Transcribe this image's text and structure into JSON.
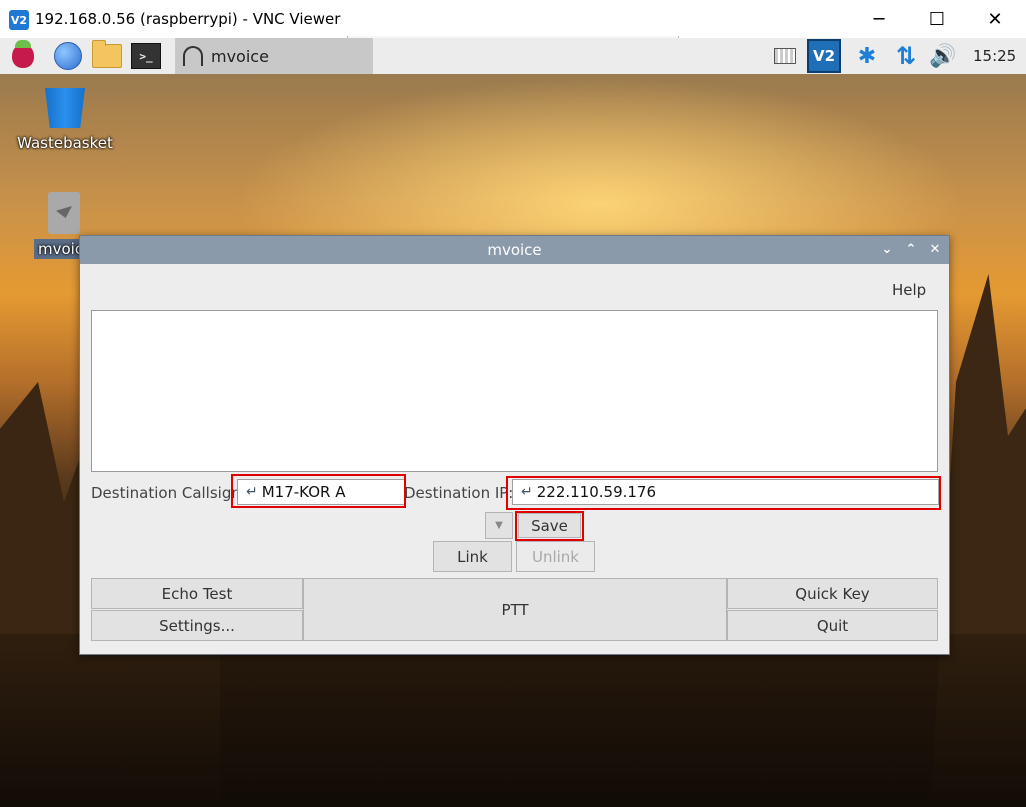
{
  "host": {
    "title": "192.168.0.56 (raspberrypi) - VNC Viewer",
    "logo_text": "V2",
    "controls": {
      "minimize": "─",
      "maximize": "☐",
      "close": "✕"
    }
  },
  "taskbar": {
    "icons": [
      "raspberry-menu-icon",
      "web-browser-icon",
      "file-manager-icon",
      "terminal-icon"
    ],
    "terminal_glyph": ">_",
    "active_task": "mvoice",
    "tray": {
      "vnc_text": "V2",
      "bluetooth": "✱",
      "network": "⇅",
      "volume": "🔊"
    },
    "clock": "15:25"
  },
  "desktop": {
    "items": [
      {
        "label": "Wastebasket",
        "icon": "wastebasket-icon"
      },
      {
        "label": "mvoice",
        "icon": "mvoice-file-icon"
      }
    ]
  },
  "mvoice_window": {
    "title": "mvoice",
    "controls": {
      "minimize": "⌄",
      "maximize": "⌃",
      "close": "✕"
    },
    "menu": {
      "help": "Help"
    },
    "log_text": "",
    "destination_callsign": {
      "label": "Destination Callsign:",
      "value": "M17-KOR A"
    },
    "destination_ip": {
      "label": "Destination IP:",
      "value": "222.110.59.176"
    },
    "entry_icon": "↵",
    "dropdown_glyph": "▼",
    "buttons": {
      "save": "Save",
      "link": "Link",
      "unlink": "Unlink",
      "echo_test": "Echo Test",
      "settings": "Settings...",
      "ptt": "PTT",
      "quick_key": "Quick Key",
      "quit": "Quit"
    },
    "highlight_color": "#e00000"
  }
}
